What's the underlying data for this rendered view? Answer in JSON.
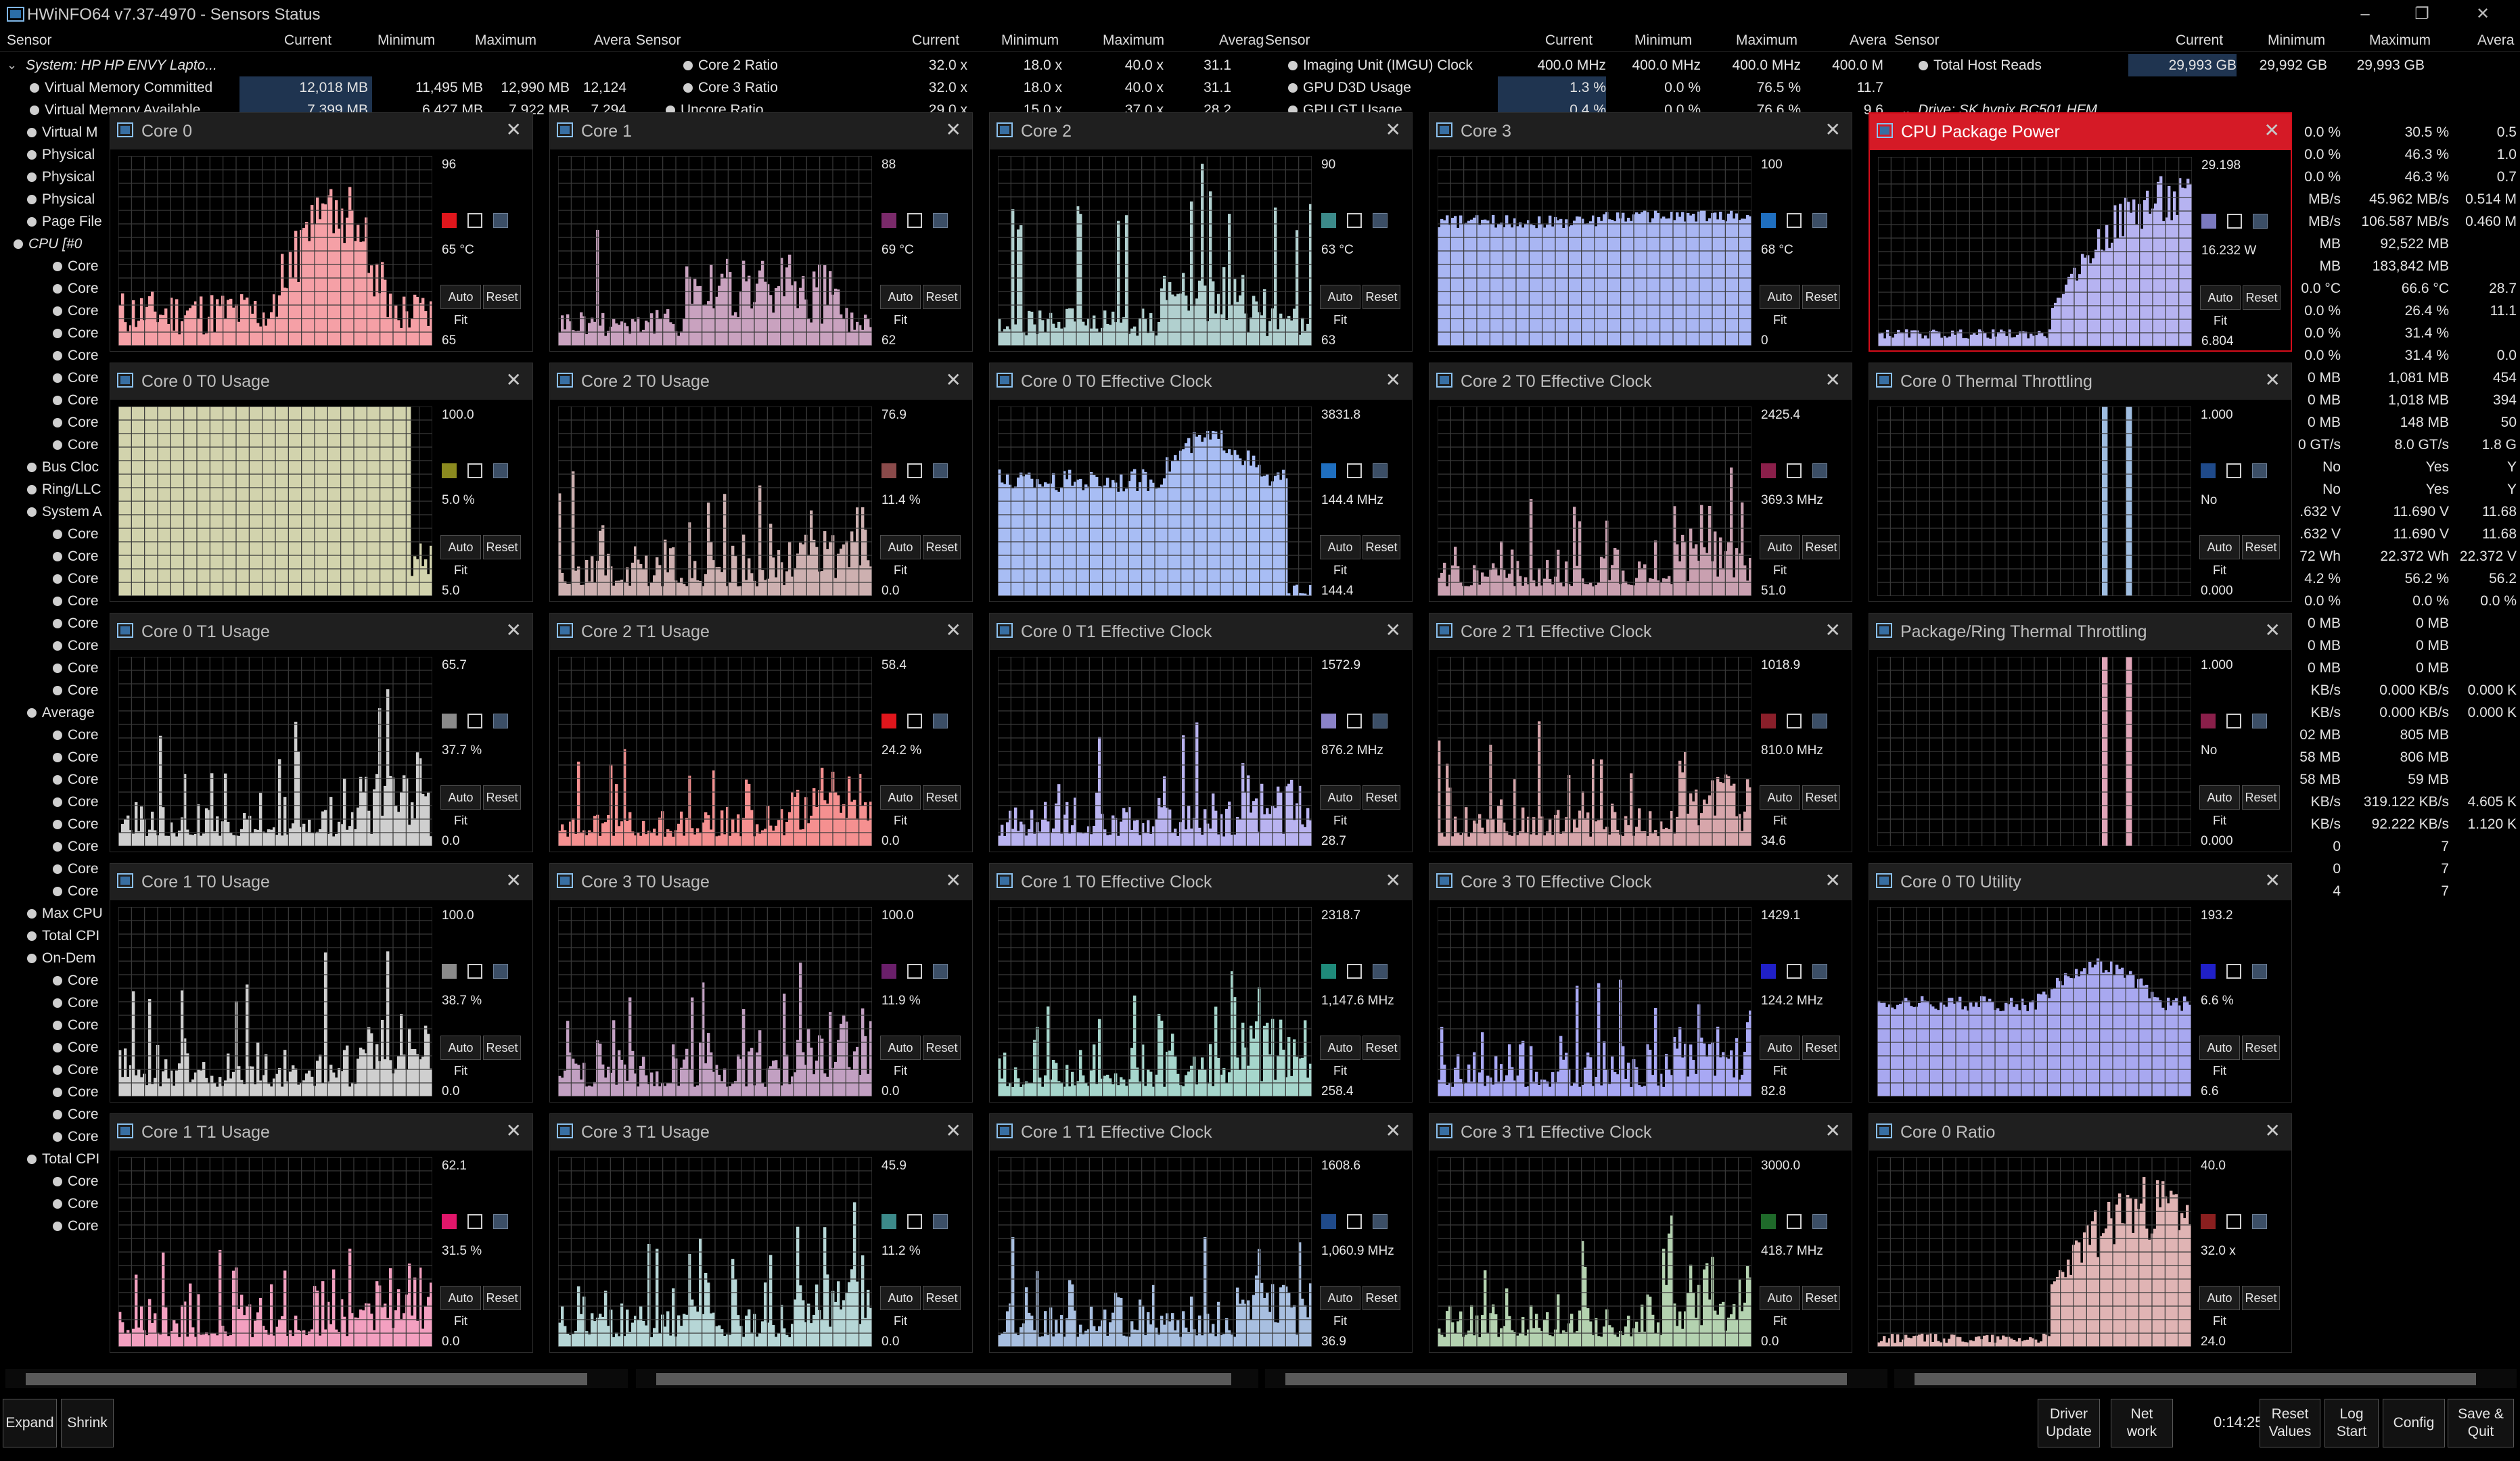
{
  "window": {
    "title": "HWiNFO64 v7.37-4970 - Sensors Status"
  },
  "headers": [
    {
      "sensor": "Sensor",
      "current": "Current",
      "minimum": "Minimum",
      "maximum": "Maximum",
      "average": "Avera"
    },
    {
      "sensor": "Sensor",
      "current": "Current",
      "minimum": "Minimum",
      "maximum": "Maximum",
      "average": "Averag"
    },
    {
      "sensor": "Sensor",
      "current": "Current",
      "minimum": "Minimum",
      "maximum": "Maximum",
      "average": "Avera"
    },
    {
      "sensor": "Sensor",
      "current": "Current",
      "minimum": "Minimum",
      "maximum": "Maximum",
      "average": "Avera"
    }
  ],
  "tree": {
    "col1": {
      "system": "System: HP HP ENVY Lapto...",
      "rows": [
        {
          "label": "Virtual Memory Committed",
          "cur": "12,018 MB",
          "min": "11,495 MB",
          "max": "12,990 MB",
          "avg": "12,124"
        },
        {
          "label": "Virtual Memory Available",
          "cur": "7,399 MB",
          "min": "6,427 MB",
          "max": "7,922 MB",
          "avg": "7,294"
        }
      ],
      "labels": [
        "Virtual M",
        "Physical",
        "Physical",
        "Physical",
        "Page File",
        "CPU [#0",
        "Core",
        "Core",
        "Core",
        "Core",
        "Core",
        "Core",
        "Core",
        "Core",
        "Core",
        "Bus Cloc",
        "Ring/LLC",
        "System A",
        "Core",
        "Core",
        "Core",
        "Core",
        "Core",
        "Core",
        "Core",
        "Core",
        "Average",
        "Core",
        "Core",
        "Core",
        "Core",
        "Core",
        "Core",
        "Core",
        "Core",
        "Max CPU",
        "Total CPI",
        "On-Dem",
        "Core",
        "Core",
        "Core",
        "Core",
        "Core",
        "Core",
        "Core",
        "Core",
        "Total CPI",
        "Core",
        "Core",
        "Core"
      ]
    },
    "col2": {
      "rows": [
        {
          "label": "Core 2 Ratio",
          "cur": "32.0 x",
          "min": "18.0 x",
          "max": "40.0 x",
          "avg": "31.1"
        },
        {
          "label": "Core 3 Ratio",
          "cur": "32.0 x",
          "min": "18.0 x",
          "max": "40.0 x",
          "avg": "31.1"
        },
        {
          "label": "Uncore Ratio",
          "cur": "29.0 x",
          "min": "15.0 x",
          "max": "37.0 x",
          "avg": "28.2"
        }
      ]
    },
    "col3": {
      "rows": [
        {
          "label": "Imaging Unit (IMGU) Clock",
          "cur": "400.0 MHz",
          "min": "400.0 MHz",
          "max": "400.0 MHz",
          "avg": "400.0 M"
        },
        {
          "label": "GPU D3D Usage",
          "cur": "1.3 %",
          "min": "0.0 %",
          "max": "76.5 %",
          "avg": "11.7"
        },
        {
          "label": "GPU GT Usage",
          "cur": "0.4 %",
          "min": "0.0 %",
          "max": "76.6 %",
          "avg": "9.6"
        }
      ]
    },
    "col4": {
      "rows": [
        {
          "label": "Total Host Reads",
          "cur": "29,993 GB",
          "min": "29,992 GB",
          "max": "29,993 GB",
          "avg": ""
        }
      ],
      "drive": "Drive: SK hynix BC501 HFM...",
      "values": [
        [
          "0.0 %",
          "30.5 %",
          "0.5"
        ],
        [
          "0.0 %",
          "46.3 %",
          "1.0"
        ],
        [
          "0.0 %",
          "46.3 %",
          "0.7"
        ],
        [
          "MB/s",
          "45.962 MB/s",
          "0.514 M"
        ],
        [
          "MB/s",
          "106.587 MB/s",
          "0.460 M"
        ],
        [
          "MB",
          "92,522 MB",
          ""
        ],
        [
          "MB",
          "183,842 MB",
          ""
        ],
        [
          "0.0 °C",
          "66.6 °C",
          "28.7"
        ],
        [
          "0.0 %",
          "26.4 %",
          "11.1"
        ],
        [
          "0.0 %",
          "31.4 %",
          ""
        ],
        [
          "0.0 %",
          "31.4 %",
          "0.0"
        ],
        [
          "0 MB",
          "1,081 MB",
          "454"
        ],
        [
          "0 MB",
          "1,018 MB",
          "394"
        ],
        [
          "0 MB",
          "148 MB",
          "50"
        ],
        [
          "0 GT/s",
          "8.0 GT/s",
          "1.8 G"
        ],
        [
          "No",
          "Yes",
          "Y"
        ],
        [
          "No",
          "Yes",
          "Y"
        ],
        [
          ".632 V",
          "11.690 V",
          "11.68"
        ],
        [
          ".632 V",
          "11.690 V",
          "11.68"
        ],
        [
          "72 Wh",
          "22.372 Wh",
          "22.372 V"
        ],
        [
          "4.2 %",
          "56.2 %",
          "56.2"
        ],
        [
          "0.0 %",
          "0.0 %",
          "0.0 %"
        ],
        [
          "0 MB",
          "0 MB",
          ""
        ],
        [
          "0 MB",
          "0 MB",
          ""
        ],
        [
          "0 MB",
          "0 MB",
          ""
        ],
        [
          "KB/s",
          "0.000 KB/s",
          "0.000 K"
        ],
        [
          "KB/s",
          "0.000 KB/s",
          "0.000 K"
        ],
        [
          "02 MB",
          "805 MB",
          ""
        ],
        [
          "58 MB",
          "806 MB",
          ""
        ],
        [
          "58 MB",
          "59 MB",
          ""
        ],
        [
          "KB/s",
          "319.122 KB/s",
          "4.605 K"
        ],
        [
          "KB/s",
          "92.222 KB/s",
          "1.120 K"
        ],
        [
          "0",
          "7",
          ""
        ],
        [
          "0",
          "7",
          ""
        ],
        [
          "4",
          "7",
          ""
        ]
      ]
    }
  },
  "graphs": [
    {
      "title": "Core 0",
      "max": "96",
      "current": "65 °C",
      "min": "65",
      "color": "#e0161c",
      "fill": "#f5a0a6",
      "bars": "cpu0"
    },
    {
      "title": "Core 1",
      "max": "88",
      "current": "69 °C",
      "min": "62",
      "color": "#7a2a6a",
      "fill": "#c9a2bf",
      "bars": "core1"
    },
    {
      "title": "Core 2",
      "max": "90",
      "current": "63 °C",
      "min": "63",
      "color": "#3c8a8a",
      "fill": "#b1d0cf",
      "bars": "core2"
    },
    {
      "title": "Core 3",
      "max": "100",
      "current": "68 °C",
      "min": "0",
      "color": "#1f6fc0",
      "fill": "#a9b6f3",
      "bars": "flat"
    },
    {
      "title": "CPU Package Power",
      "max": "29.198",
      "current": "16.232 W",
      "min": "6.804",
      "color": "#7b7ac0",
      "fill": "#b6b3f1",
      "bars": "ramp",
      "active": true
    },
    {
      "title": "Core 0 T0 Usage",
      "max": "100.0",
      "current": "5.0 %",
      "min": "5.0",
      "color": "#8b8a1f",
      "fill": "#d2d3ad",
      "bars": "full"
    },
    {
      "title": "Core 2 T0 Usage",
      "max": "76.9",
      "current": "11.4 %",
      "min": "0.0",
      "color": "#8a4a4a",
      "fill": "#cdb0b0",
      "bars": "noise"
    },
    {
      "title": "Core 0 T0 Effective Clock",
      "max": "3831.8",
      "current": "144.4 MHz",
      "min": "144.4",
      "color": "#1f6fc0",
      "fill": "#a8bdf4",
      "bars": "plateau"
    },
    {
      "title": "Core 2 T0 Effective Clock",
      "max": "2425.4",
      "current": "369.3 MHz",
      "min": "51.0",
      "color": "#8a1f4a",
      "fill": "#c9a0b0",
      "bars": "noise"
    },
    {
      "title": "Core 0 Thermal Throttling",
      "max": "1.000",
      "current": "No",
      "min": "0.000",
      "color": "#1f4a8a",
      "fill": "#9fbde0",
      "bars": "spikes"
    },
    {
      "title": "Core 0 T1 Usage",
      "max": "65.7",
      "current": "37.7 %",
      "min": "0.0",
      "color": "#8a8a8a",
      "fill": "#cfcfcf",
      "bars": "noise"
    },
    {
      "title": "Core 2 T1 Usage",
      "max": "58.4",
      "current": "24.2 %",
      "min": "0.0",
      "color": "#e0161c",
      "fill": "#f59090",
      "bars": "noise"
    },
    {
      "title": "Core 0 T1 Effective Clock",
      "max": "1572.9",
      "current": "876.2 MHz",
      "min": "28.7",
      "color": "#8a82c8",
      "fill": "#b9b3f0",
      "bars": "noise"
    },
    {
      "title": "Core 2 T1 Effective Clock",
      "max": "1018.9",
      "current": "810.0 MHz",
      "min": "34.6",
      "color": "#8a1f2a",
      "fill": "#d7a6ab",
      "bars": "noise"
    },
    {
      "title": "Package/Ring Thermal Throttling",
      "max": "1.000",
      "current": "No",
      "min": "0.000",
      "color": "#8a1f4a",
      "fill": "#e0a5b8",
      "bars": "spikes"
    },
    {
      "title": "Core 1 T0 Usage",
      "max": "100.0",
      "current": "38.7 %",
      "min": "0.0",
      "color": "#8a8a8a",
      "fill": "#cfcfcf",
      "bars": "noise"
    },
    {
      "title": "Core 3 T0 Usage",
      "max": "100.0",
      "current": "11.9 %",
      "min": "0.0",
      "color": "#6a1f6a",
      "fill": "#c2a0c2",
      "bars": "noise"
    },
    {
      "title": "Core 1 T0 Effective Clock",
      "max": "2318.7",
      "current": "1,147.6 MHz",
      "min": "258.4",
      "color": "#1f8a7a",
      "fill": "#a6d6cc",
      "bars": "noise"
    },
    {
      "title": "Core 3 T0 Effective Clock",
      "max": "1429.1",
      "current": "124.2 MHz",
      "min": "82.8",
      "color": "#2020c8",
      "fill": "#a8a8f4",
      "bars": "noise"
    },
    {
      "title": "Core 0 T0 Utility",
      "max": "193.2",
      "current": "6.6 %",
      "min": "6.6",
      "color": "#2020c8",
      "fill": "#a8a8f0",
      "bars": "plateau2"
    },
    {
      "title": "Core 1 T1 Usage",
      "max": "62.1",
      "current": "31.5 %",
      "min": "0.0",
      "color": "#e0166a",
      "fill": "#f3a0c0",
      "bars": "noise"
    },
    {
      "title": "Core 3 T1 Usage",
      "max": "45.9",
      "current": "11.2 %",
      "min": "0.0",
      "color": "#3c8a8a",
      "fill": "#b6d6d6",
      "bars": "noise"
    },
    {
      "title": "Core 1 T1 Effective Clock",
      "max": "1608.6",
      "current": "1,060.9 MHz",
      "min": "36.9",
      "color": "#1f4a8a",
      "fill": "#a8bfe0",
      "bars": "noise"
    },
    {
      "title": "Core 3 T1 Effective Clock",
      "max": "3000.0",
      "current": "418.7 MHz",
      "min": "0.0",
      "color": "#1f6a2a",
      "fill": "#b4d2b0",
      "bars": "noise"
    },
    {
      "title": "Core 0 Ratio",
      "max": "40.0",
      "current": "32.0 x",
      "min": "24.0",
      "color": "#8a1f1f",
      "fill": "#e0b4b4",
      "bars": "ramp2"
    }
  ],
  "graph_buttons": {
    "autofit": "Auto Fit",
    "reset": "Reset"
  },
  "toolbar": {
    "expand": "Expand",
    "shrink": "Shrink",
    "driver_update": "Driver\nUpdate",
    "network": "Net\nwork",
    "elapsed": "0:14:25",
    "reset_values": "Reset\nValues",
    "log_start": "Log\nStart",
    "config": "Config",
    "save_quit": "Save &\nQuit"
  }
}
